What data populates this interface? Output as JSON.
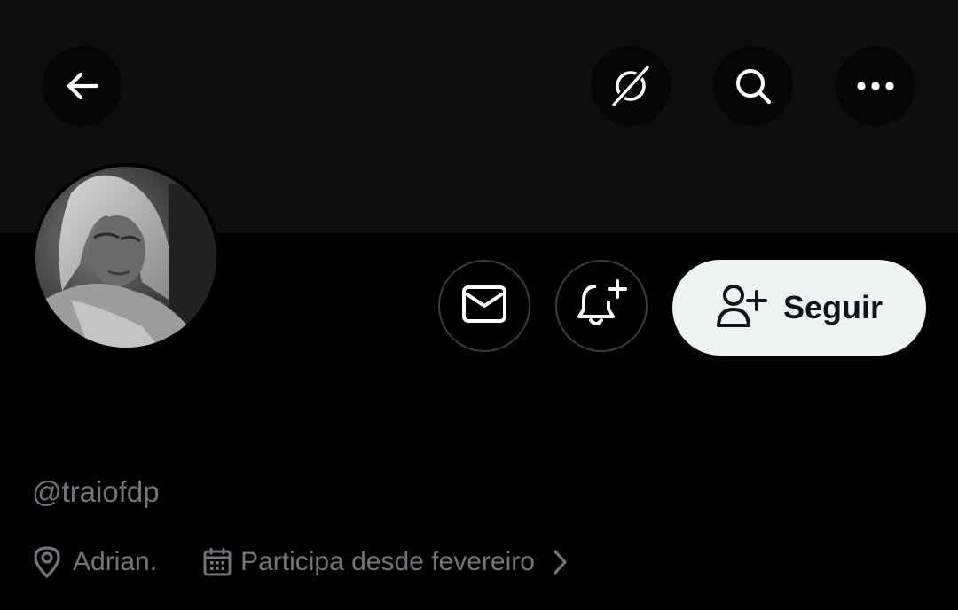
{
  "profile": {
    "handle": "@traiofdp",
    "location": "Adrian.",
    "joined": "Participa desde fevereiro"
  },
  "actions": {
    "follow_label": "Seguir"
  },
  "icons": {
    "back": "arrow-left-icon",
    "grok": "grok-icon",
    "search": "search-icon",
    "more": "more-horizontal-icon",
    "message": "envelope-icon",
    "notify": "bell-plus-icon",
    "follow": "person-plus-icon",
    "location": "location-pin-icon",
    "calendar": "calendar-icon",
    "chevron": "chevron-right-icon"
  },
  "colors": {
    "background": "#000000",
    "banner": "#0e0e0e",
    "icon_button": "#060606",
    "primary_text": "#e7e9ea",
    "secondary_text": "#71767b",
    "follow_bg": "#eff3f4",
    "follow_text": "#0f1419",
    "outline": "#3a3d41"
  }
}
